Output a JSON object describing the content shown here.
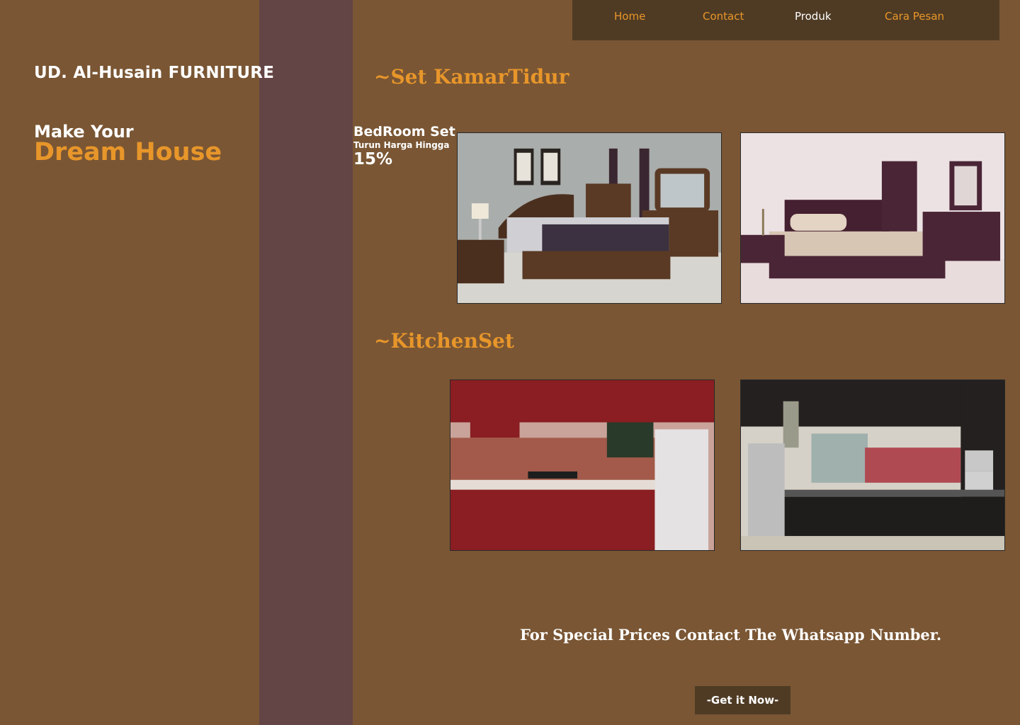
{
  "brand": {
    "name": "UD. Al-Husain FURNITURE"
  },
  "hero": {
    "line1": "Make Your",
    "line2": "Dream House"
  },
  "nav": {
    "items": [
      {
        "label": "Home"
      },
      {
        "label": "Contact"
      },
      {
        "label": "Produk"
      },
      {
        "label": "Cara Pesan"
      }
    ],
    "active": "Produk"
  },
  "sections": {
    "bedroom": {
      "title": "~Set KamarTidur",
      "promo": {
        "name": "BedRoom Set",
        "sub": "Turun Harga Hingga",
        "discount": "15%"
      },
      "images": [
        "bedroom-photo-brown",
        "bedroom-photo-purple"
      ]
    },
    "kitchen": {
      "title": "~KitchenSet",
      "images": [
        "kitchen-photo-red",
        "kitchen-photo-black"
      ]
    }
  },
  "contact": {
    "message": "For Special Prices Contact The Whatsapp Number."
  },
  "cta": {
    "label": "-Get it  Now-"
  },
  "colors": {
    "background": "#7a5634",
    "stripe": "#644545",
    "nav_bg": "#4f3b24",
    "accent": "#e8962a",
    "text": "#ffffff"
  }
}
